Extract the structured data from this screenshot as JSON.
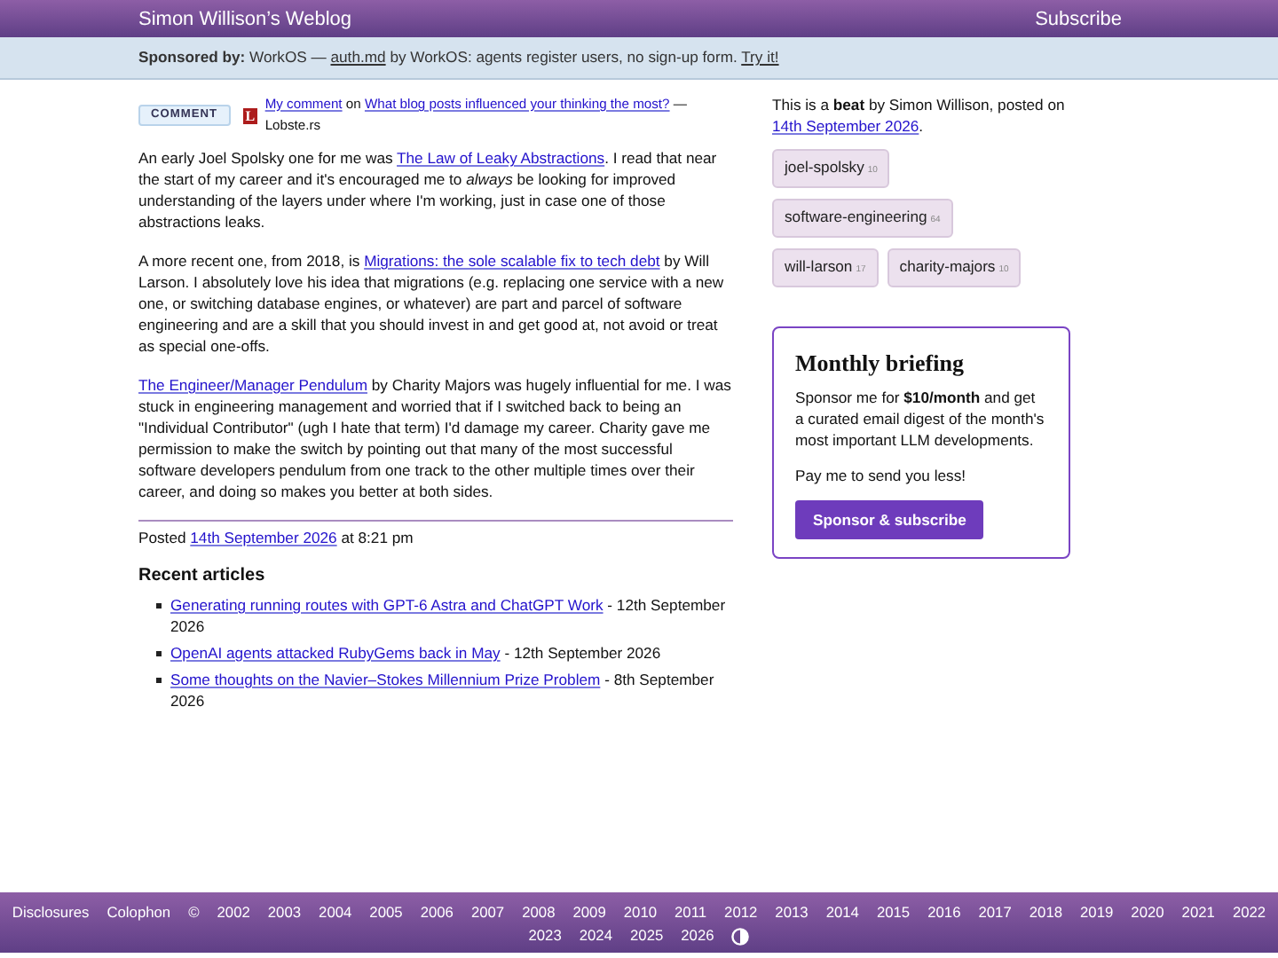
{
  "header": {
    "title": "Simon Willison’s Weblog",
    "subscribe": "Subscribe"
  },
  "sponsor_bar": {
    "label": "Sponsored by:",
    "parts": [
      {
        "kind": "text",
        "text": " WorkOS — "
      },
      {
        "kind": "link",
        "text": "auth.md"
      },
      {
        "kind": "text",
        "text": " by WorkOS: agents register users, no sign-up form. "
      },
      {
        "kind": "link",
        "text": "Try it!"
      }
    ]
  },
  "entry": {
    "badge": "COMMENT",
    "site_logo": "L",
    "source_parts": [
      {
        "kind": "link",
        "text": "My comment"
      },
      {
        "kind": "text",
        "text": " on "
      },
      {
        "kind": "link",
        "text": "What blog posts influenced your thinking the most?"
      },
      {
        "kind": "text",
        "text": " — Lobste.rs"
      }
    ],
    "paragraphs": [
      {
        "parts": [
          {
            "kind": "text",
            "text": "An early Joel Spolsky one for me was "
          },
          {
            "kind": "link",
            "text": "The Law of Leaky Abstractions"
          },
          {
            "kind": "text",
            "text": ". I read that near the start of my career and it's encouraged me to *always* be looking for improved understanding of the layers under where I'm working, just in case one of those abstractions leaks."
          }
        ]
      },
      {
        "parts": [
          {
            "kind": "text",
            "text": "A more recent one, from 2018, is "
          },
          {
            "kind": "link",
            "text": "Migrations: the sole scalable fix to tech debt"
          },
          {
            "kind": "text",
            "text": " by Will Larson. I absolutely love his idea that migrations (e.g. replacing one service with a new one, or switching database engines, or whatever) are part and parcel of software engineering and are a skill that you should invest in and get good at, not avoid or treat as special one-offs."
          }
        ]
      },
      {
        "parts": [
          {
            "kind": "link",
            "text": "The Engineer/Manager Pendulum"
          },
          {
            "kind": "text",
            "text": " by Charity Majors was hugely influential for me. I was stuck in engineering management and worried that if I switched back to being an \"Individual Contributor\" (ugh I hate that term) I'd damage my career. Charity gave me permission to make the switch by pointing out that many of the most successful software developers pendulum from one track to the other multiple times over their career, and doing so makes you better at both sides."
          }
        ]
      }
    ],
    "posted": {
      "label": "Posted",
      "date": "14th September 2026",
      "time": "at 8:21 pm"
    },
    "recent": {
      "heading": "Recent articles",
      "items": [
        {
          "title": "Generating running routes with GPT-6 Astra and ChatGPT Work",
          "date": " - 12th September 2026"
        },
        {
          "title": "OpenAI agents attacked RubyGems back in May",
          "date": " - 12th September 2026"
        },
        {
          "title": "Some thoughts on the Navier–Stokes Millennium Prize Problem",
          "date": " - 8th September 2026"
        }
      ]
    }
  },
  "sidebar": {
    "intro": "This is a **beat** by Simon Willison, posted on",
    "date": "14th September 2026",
    "after_date": ".",
    "tags": [
      {
        "name": "joel-spolsky",
        "count": "10"
      },
      {
        "name": "software-engineering",
        "count": "64"
      },
      {
        "name": "will-larson",
        "count": "17"
      },
      {
        "name": "charity-majors",
        "count": "10"
      }
    ],
    "briefing": {
      "title": "Monthly briefing",
      "text": "Sponsor me for **$10/month** and get a curated email digest of the month's most important LLM developments.",
      "note": "Pay me to send you less!",
      "button": "Sponsor & subscribe"
    }
  },
  "footer": {
    "links": [
      "Disclosures",
      "Colophon"
    ],
    "copyright": "©",
    "years": [
      "2002",
      "2003",
      "2004",
      "2005",
      "2006",
      "2007",
      "2008",
      "2009",
      "2010",
      "2011",
      "2012",
      "2013",
      "2014",
      "2015",
      "2016",
      "2017",
      "2018",
      "2019",
      "2020",
      "2021",
      "2022",
      "2023",
      "2024",
      "2025",
      "2026"
    ]
  }
}
